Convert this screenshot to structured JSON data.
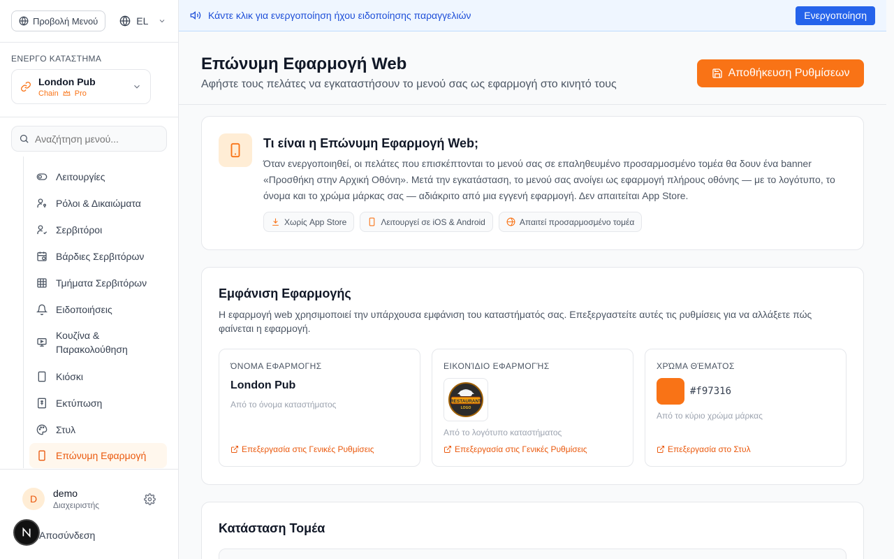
{
  "sidebar": {
    "menu_preview": "Προβολή Μενού",
    "language": "EL",
    "active_store_label": "ΕΝΕΡΓΟ ΚΑΤΑΣΤΗΜΑ",
    "store": {
      "name": "London Pub",
      "type": "Chain",
      "plan": "Pro"
    },
    "search_placeholder": "Αναζήτηση μενού...",
    "items": [
      {
        "label": "Λειτουργίες",
        "icon": "toggle-icon"
      },
      {
        "label": "Ρόλοι & Δικαιώματα",
        "icon": "user-key-icon"
      },
      {
        "label": "Σερβιτόροι",
        "icon": "user-check-icon"
      },
      {
        "label": "Βάρδιες Σερβιτόρων",
        "icon": "calendar-clock-icon"
      },
      {
        "label": "Τμήματα Σερβιτόρων",
        "icon": "grid-icon"
      },
      {
        "label": "Ειδοποιήσεις",
        "icon": "bell-icon"
      },
      {
        "label": "Κουζίνα &",
        "label2": "Παρακολούθηση",
        "icon": "monitor-icon"
      },
      {
        "label": "Κιόσκι",
        "icon": "tablet-icon"
      },
      {
        "label": "Εκτύπωση",
        "icon": "receipt-icon"
      },
      {
        "label": "Στυλ",
        "icon": "palette-icon"
      },
      {
        "label": "Επώνυμη Εφαρμογή",
        "icon": "smartphone-icon",
        "active": true
      }
    ],
    "user": {
      "initial": "D",
      "name": "demo",
      "role": "Διαχειριστής"
    },
    "logout": "Αποσύνδεση",
    "badge": "N"
  },
  "banner": {
    "text": "Κάντε κλικ για ενεργοποίηση ήχου ειδοποίησης παραγγελιών",
    "button": "Ενεργοποίηση"
  },
  "header": {
    "title": "Επώνυμη Εφαρμογή Web",
    "subtitle": "Αφήστε τους πελάτες να εγκαταστήσουν το μενού σας ως εφαρμογή στο κινητό τους",
    "save": "Αποθήκευση Ρυθμίσεων"
  },
  "info": {
    "title": "Τι είναι η Επώνυμη Εφαρμογή Web;",
    "description": "Όταν ενεργοποιηθεί, οι πελάτες που επισκέπτονται το μενού σας σε επαληθευμένο προσαρμοσμένο τομέα θα δουν ένα banner «Προσθήκη στην Αρχική Οθόνη». Μετά την εγκατάσταση, το μενού σας ανοίγει ως εφαρμογή πλήρους οθόνης — με το λογότυπο, το όνομα και το χρώμα μάρκας σας — αδιάκριτο από μια εγγενή εφαρμογή. Δεν απαιτείται App Store.",
    "chips": [
      "Χωρίς App Store",
      "Λειτουργεί σε iOS & Android",
      "Απαιτεί προσαρμοσμένο τομέα"
    ]
  },
  "appearance": {
    "title": "Εμφάνιση Εφαρμογής",
    "description": "Η εφαρμογή web χρησιμοποιεί την υπάρχουσα εμφάνιση του καταστήματός σας. Επεξεργαστείτε αυτές τις ρυθμίσεις για να αλλάξετε πώς φαίνεται η εφαρμογή.",
    "name_card": {
      "label": "ΌΝΟΜΑ ΕΦΑΡΜΟΓΗΣ",
      "value": "London Pub",
      "note": "Από το όνομα καταστήματος",
      "link": "Επεξεργασία στις Γενικές Ρυθμίσεις"
    },
    "icon_card": {
      "label": "ΕΙΚΟΝΊΔΙΟ ΕΦΑΡΜΟΓΉΣ",
      "logo_text": "RESTAURANT",
      "logo_sub": "LOGO",
      "note": "Από το λογότυπο καταστήματος",
      "link": "Επεξεργασία στις Γενικές Ρυθμίσεις"
    },
    "color_card": {
      "label": "ΧΡΏΜΑ ΘΈΜΑΤΟΣ",
      "value": "#f97316",
      "note": "Από το κύριο χρώμα μάρκας",
      "link": "Επεξεργασία στο Στυλ"
    }
  },
  "domain": {
    "title": "Κατάσταση Τομέα"
  },
  "colors": {
    "accent": "#f97316",
    "banner_blue": "#2563eb"
  }
}
